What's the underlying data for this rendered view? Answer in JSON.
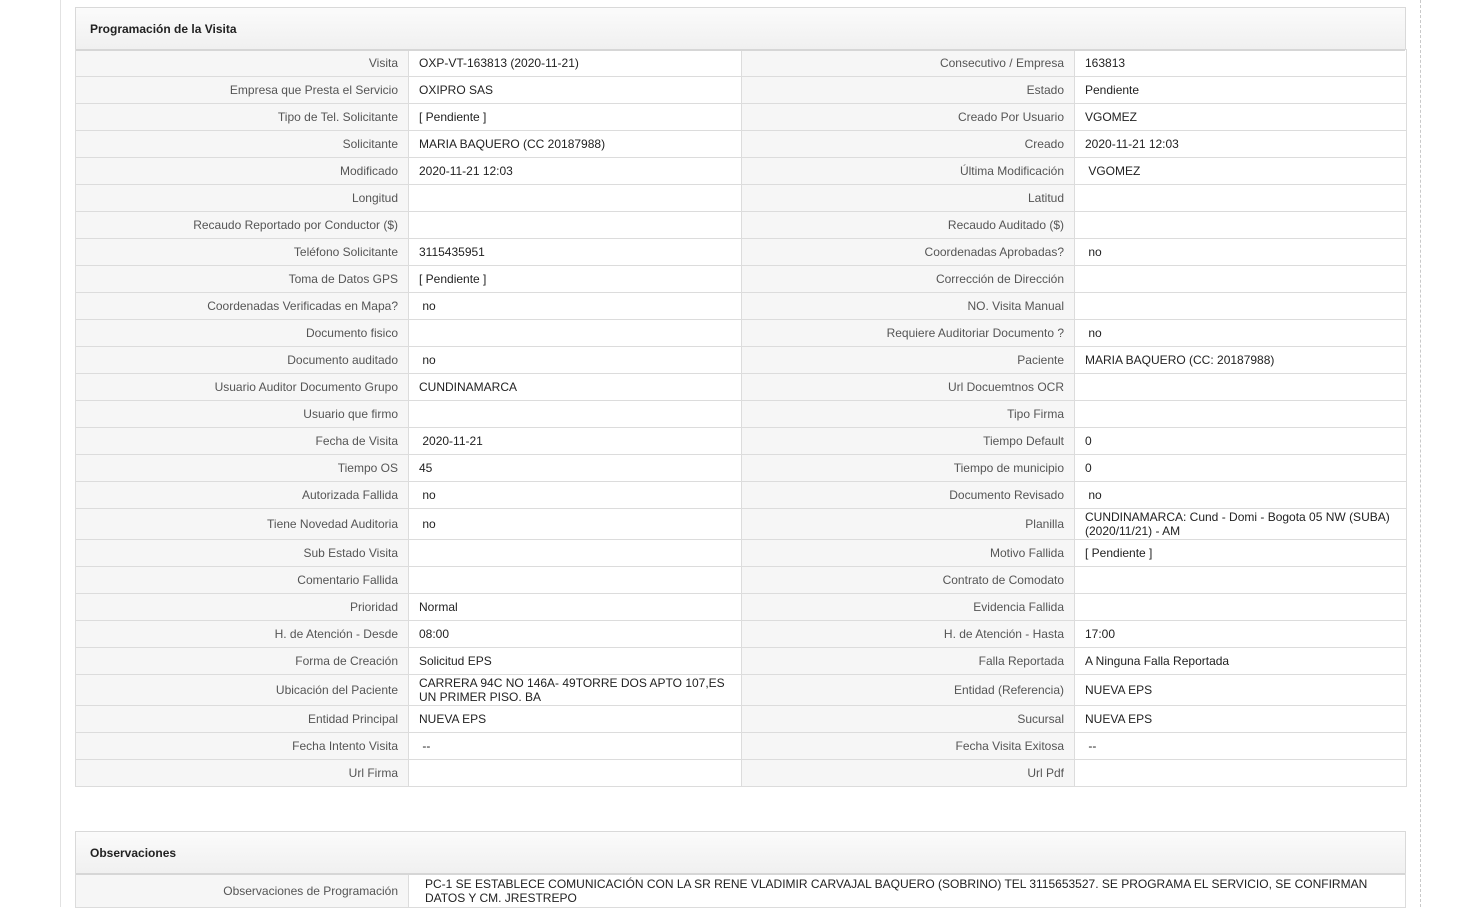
{
  "section1": {
    "title": "Programación de la Visita",
    "rows": [
      {
        "l1": "Visita",
        "v1": "OXP-VT-163813 (2020-11-21)",
        "l2": "Consecutivo / Empresa",
        "v2": "163813"
      },
      {
        "l1": "Empresa que Presta el Servicio",
        "v1": "OXIPRO SAS",
        "l2": "Estado",
        "v2": "Pendiente"
      },
      {
        "l1": "Tipo de Tel. Solicitante",
        "v1": "[ Pendiente ]",
        "l2": "Creado Por Usuario",
        "v2": "VGOMEZ"
      },
      {
        "l1": "Solicitante",
        "v1": "MARIA BAQUERO (CC 20187988)",
        "l2": "Creado",
        "v2": "2020-11-21 12:03"
      },
      {
        "l1": "Modificado",
        "v1": "2020-11-21 12:03",
        "l2": "Última Modificación",
        "v2": " VGOMEZ"
      },
      {
        "l1": "Longitud",
        "v1": "",
        "l2": "Latitud",
        "v2": ""
      },
      {
        "l1": "Recaudo Reportado por Conductor ($)",
        "v1": "",
        "l2": "Recaudo Auditado ($)",
        "v2": ""
      },
      {
        "l1": "Teléfono Solicitante",
        "v1": "3115435951",
        "l2": "Coordenadas Aprobadas?",
        "v2": " no"
      },
      {
        "l1": "Toma de Datos GPS",
        "v1": "[ Pendiente ]",
        "l2": "Corrección de Dirección",
        "v2": ""
      },
      {
        "l1": "Coordenadas Verificadas en Mapa?",
        "v1": " no",
        "l2": "NO. Visita Manual",
        "v2": ""
      },
      {
        "l1": "Documento fisico",
        "v1": "",
        "l2": "Requiere Auditoriar Documento ?",
        "v2": " no"
      },
      {
        "l1": "Documento auditado",
        "v1": " no",
        "l2": "Paciente",
        "v2": "MARIA BAQUERO (CC: 20187988)"
      },
      {
        "l1": "Usuario Auditor Documento Grupo",
        "v1": "CUNDINAMARCA",
        "l2": "Url Docuemtnos OCR",
        "v2": ""
      },
      {
        "l1": "Usuario que firmo",
        "v1": "",
        "l2": "Tipo Firma",
        "v2": ""
      },
      {
        "l1": "Fecha de Visita",
        "v1": " 2020-11-21",
        "l2": "Tiempo Default",
        "v2": "0"
      },
      {
        "l1": "Tiempo OS",
        "v1": "45",
        "l2": "Tiempo de municipio",
        "v2": "0"
      },
      {
        "l1": "Autorizada Fallida",
        "v1": " no",
        "l2": "Documento Revisado",
        "v2": " no"
      },
      {
        "l1": "Tiene Novedad Auditoria",
        "v1": " no",
        "l2": "Planilla",
        "v2": "CUNDINAMARCA: Cund - Domi - Bogota 05 NW (SUBA) (2020/11/21) - AM"
      },
      {
        "l1": "Sub Estado Visita",
        "v1": "",
        "l2": "Motivo Fallida",
        "v2": "[ Pendiente ]"
      },
      {
        "l1": "Comentario Fallida",
        "v1": "",
        "l2": "Contrato de Comodato",
        "v2": ""
      },
      {
        "l1": "Prioridad",
        "v1": "Normal",
        "l2": "Evidencia Fallida",
        "v2": ""
      },
      {
        "l1": "H. de Atención - Desde",
        "v1": "08:00",
        "l2": "H. de Atención - Hasta",
        "v2": "17:00"
      },
      {
        "l1": "Forma de Creación",
        "v1": "Solicitud EPS",
        "l2": "Falla Reportada",
        "v2": "A Ninguna Falla Reportada"
      },
      {
        "l1": "Ubicación del Paciente",
        "v1": "CARRERA 94C NO 146A- 49TORRE DOS APTO 107,ES UN PRIMER PISO. BA",
        "l2": "Entidad (Referencia)",
        "v2": "NUEVA EPS"
      },
      {
        "l1": "Entidad Principal",
        "v1": "NUEVA EPS",
        "l2": "Sucursal",
        "v2": "NUEVA EPS"
      },
      {
        "l1": "Fecha Intento Visita",
        "v1": " --",
        "l2": "Fecha Visita Exitosa",
        "v2": " --"
      },
      {
        "l1": "Url Firma",
        "v1": "",
        "l2": "Url Pdf",
        "v2": ""
      }
    ]
  },
  "section2": {
    "title": "Observaciones",
    "label": "Observaciones de Programación",
    "value": " PC-1 SE ESTABLECE COMUNICACIÓN CON LA SR RENE VLADIMIR CARVAJAL BAQUERO (SOBRINO) TEL 3115653527. SE PROGRAMA EL SERVICIO, SE CONFIRMAN DATOS Y CM. JRESTREPO"
  }
}
